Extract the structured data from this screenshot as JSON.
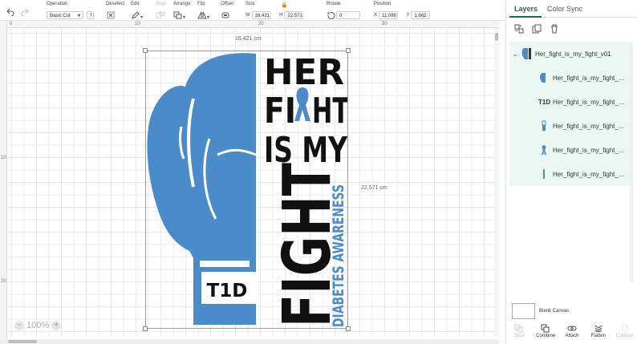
{
  "toolbar": {
    "operation_label": "Operation",
    "operation_value": "Basic Cut",
    "deselect_label": "Deselect",
    "edit_label": "Edit",
    "align_label": "Align",
    "arrange_label": "Arrange",
    "flip_label": "Flip",
    "offset_label": "Offset",
    "size_label": "Size",
    "w_label": "W",
    "w_value": "16.421",
    "h_label": "H",
    "h_value": "22.571",
    "rotate_label": "Rotate",
    "rotate_value": "0",
    "position_label": "Position",
    "x_label": "X",
    "x_value": "11.086",
    "y_label": "Y",
    "y_value": "1.662"
  },
  "rulers": {
    "h_marks": [
      "0",
      "10",
      "20",
      "30"
    ],
    "v_marks": [
      "10",
      "20"
    ]
  },
  "canvas": {
    "width_dim": "16.421 cm",
    "height_dim": "22.571 cm",
    "zoom_value": "100%",
    "zoom_minus": "−",
    "zoom_plus": "+"
  },
  "artwork": {
    "line1": "HER",
    "line2a": "FI",
    "line2b": "HT",
    "line3": "IS MY",
    "line4": "FIGHT",
    "vertical": "DIABETES AWARENESS",
    "badge": "T1D"
  },
  "panel": {
    "tabs": [
      "Layers",
      "Color Sync"
    ],
    "group_name": "Her_fight_is_my_fight_v01",
    "layers": [
      {
        "icon": "glove-icon",
        "name": "Her_fight_is_my_fight_..."
      },
      {
        "icon": "t1d-text-icon",
        "name": "Her_fight_is_my_fight_...",
        "icon_text": "T1D"
      },
      {
        "icon": "cuff-icon",
        "name": "Her_fight_is_my_fight_..."
      },
      {
        "icon": "ribbon-icon",
        "name": "Her_fight_is_my_fight_..."
      },
      {
        "icon": "line-icon",
        "name": "Her_fight_is_my_fight_..."
      }
    ],
    "blank_canvas": "Blank Canvas",
    "bottom_tools": [
      "Slice",
      "Combine",
      "Attach",
      "Flatten",
      "Contour"
    ]
  },
  "colors": {
    "accent": "#1a6a5a",
    "artwork_blue": "#4a8bc9",
    "layer_bg": "#eaf7f3"
  }
}
